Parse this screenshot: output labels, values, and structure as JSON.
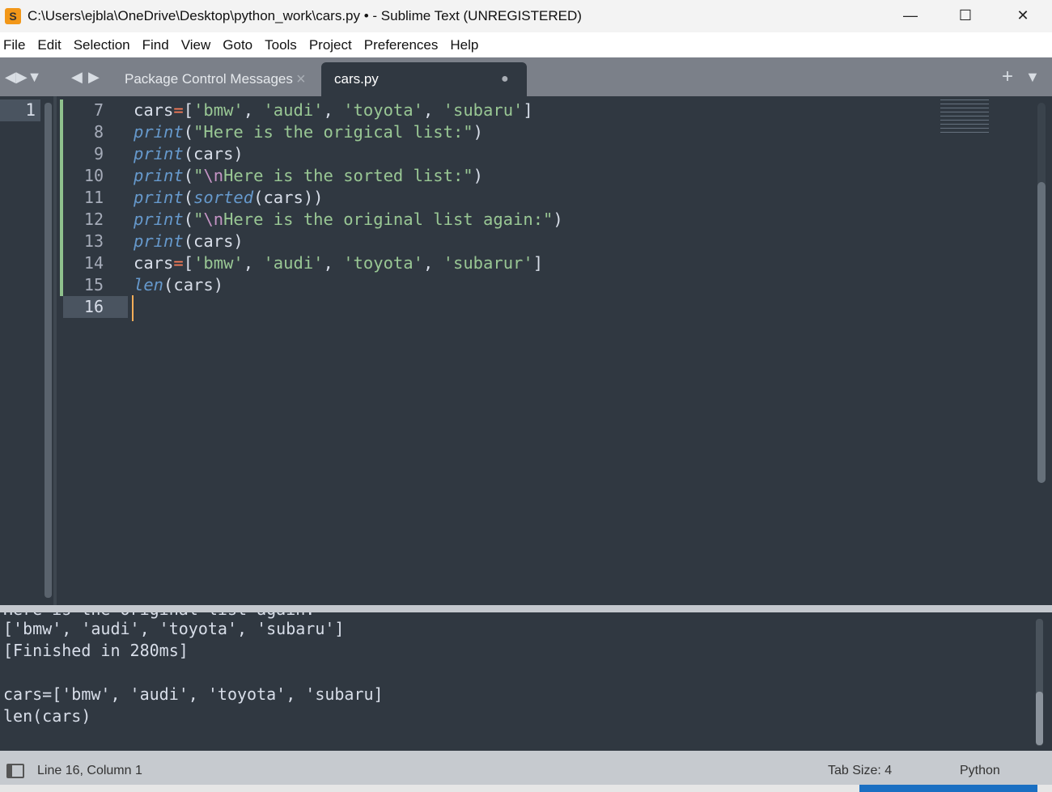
{
  "window": {
    "title": "C:\\Users\\ejbla\\OneDrive\\Desktop\\python_work\\cars.py • - Sublime Text (UNREGISTERED)",
    "app_icon": "sublime-icon"
  },
  "menu": [
    "File",
    "Edit",
    "Selection",
    "Find",
    "View",
    "Goto",
    "Tools",
    "Project",
    "Preferences",
    "Help"
  ],
  "tabs": [
    {
      "label": "Package Control Messages",
      "close": "×"
    },
    {
      "label": "cars.py",
      "dirty": "●"
    }
  ],
  "left_pane": {
    "line": "1"
  },
  "editor": {
    "lines": [
      {
        "n": "7"
      },
      {
        "n": "8"
      },
      {
        "n": "9"
      },
      {
        "n": "10"
      },
      {
        "n": "11"
      },
      {
        "n": "12"
      },
      {
        "n": "13"
      },
      {
        "n": "14"
      },
      {
        "n": "15"
      },
      {
        "n": "16"
      }
    ],
    "code": [
      "cars=['bmw', 'audi', 'toyota', 'subaru']",
      "print(\"Here is the origical list:\")",
      "print(cars)",
      "print(\"\\nHere is the sorted list:\")",
      "print(sorted(cars))",
      "print(\"\\nHere is the original list again:\")",
      "print(cars)",
      "cars=['bmw', 'audi', 'toyota', 'subarur']",
      "len(cars)",
      ""
    ]
  },
  "output": [
    "Here is the original list again:",
    "['bmw', 'audi', 'toyota', 'subaru']",
    "[Finished in 280ms]",
    "",
    "cars=['bmw', 'audi', 'toyota', 'subaru]",
    "len(cars)"
  ],
  "status": {
    "position": "Line 16, Column 1",
    "tab_size": "Tab Size: 4",
    "syntax": "Python"
  },
  "colors": {
    "bg": "#303841",
    "string": "#99c794",
    "keyword": "#6699cc",
    "operator": "#f97b58",
    "caret": "#f9ae58"
  }
}
